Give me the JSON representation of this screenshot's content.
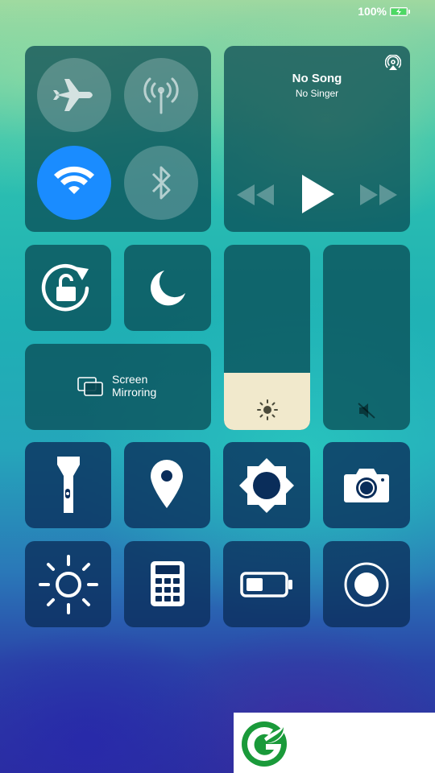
{
  "status_bar": {
    "battery_percent": "100%",
    "battery_state": "charging"
  },
  "connectivity": {
    "airplane": {
      "icon": "airplane-icon",
      "active": false
    },
    "cellular": {
      "icon": "antenna-icon",
      "active": false
    },
    "wifi": {
      "icon": "wifi-icon",
      "active": true
    },
    "bluetooth": {
      "icon": "bluetooth-icon",
      "active": false
    }
  },
  "music": {
    "title": "No Song",
    "artist": "No Singer",
    "controls": [
      "previous-icon",
      "play-icon",
      "next-icon"
    ],
    "airplay_icon": "airplay-icon"
  },
  "toggles": {
    "rotation_lock": {
      "icon": "rotation-lock-icon"
    },
    "do_not_disturb": {
      "icon": "moon-icon"
    }
  },
  "screen_mirroring": {
    "label_line1": "Screen",
    "label_line2": "Mirroring",
    "icon": "screen-mirroring-icon"
  },
  "brightness": {
    "level": 0.31,
    "icon": "sun-small-icon"
  },
  "volume": {
    "level": 0.0,
    "muted": true,
    "icon": "mute-icon"
  },
  "shortcuts": [
    {
      "name": "flashlight",
      "icon": "flashlight-icon"
    },
    {
      "name": "location",
      "icon": "location-pin-icon"
    },
    {
      "name": "auto-brightness",
      "icon": "brightness-gear-icon"
    },
    {
      "name": "camera",
      "icon": "camera-icon"
    },
    {
      "name": "display",
      "icon": "sun-icon"
    },
    {
      "name": "calculator",
      "icon": "calculator-icon"
    },
    {
      "name": "battery",
      "icon": "battery-icon"
    },
    {
      "name": "screen-record",
      "icon": "record-icon"
    }
  ],
  "colors": {
    "accent": "#1a8cff",
    "slider_fill": "#f1e9cc",
    "tile": "#0a4650",
    "logo_green": "#1a9a3a"
  },
  "watermark": {
    "logo": "leaf-g-logo"
  }
}
